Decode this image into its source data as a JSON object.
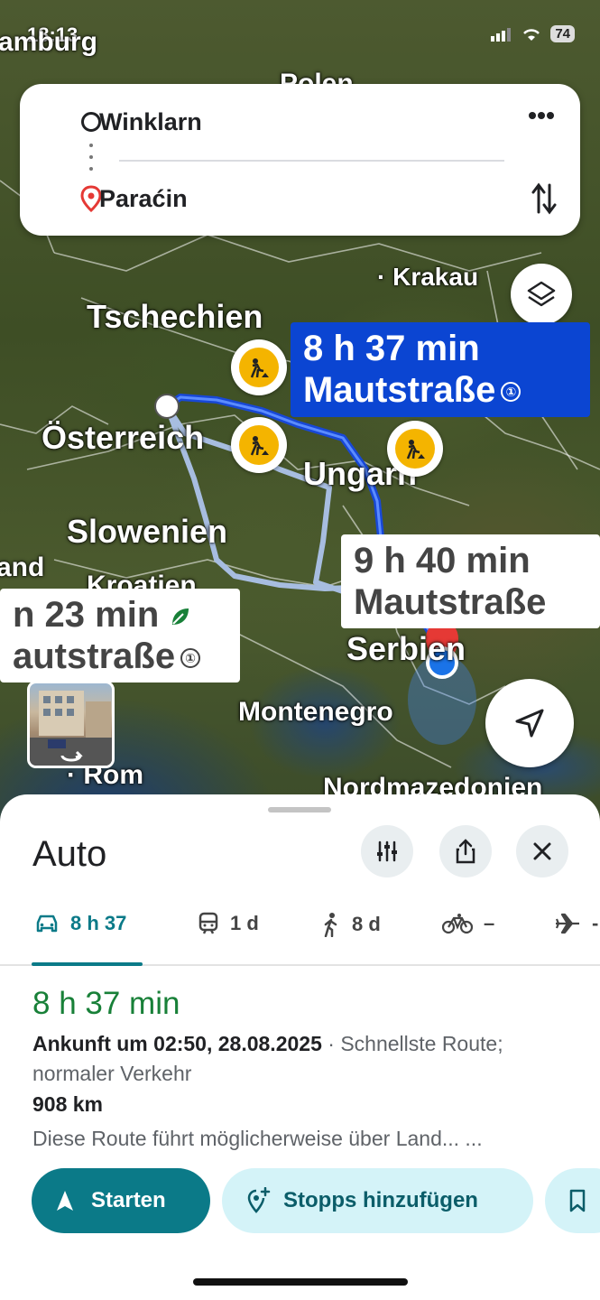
{
  "status_bar": {
    "time": "18:13",
    "battery": "74"
  },
  "map": {
    "places": [
      {
        "name": "amburg"
      },
      {
        "name": "Polen"
      },
      {
        "name": "Krakau"
      },
      {
        "name": "Tschechien"
      },
      {
        "name": "Österreich"
      },
      {
        "name": "Ungarn"
      },
      {
        "name": "Slowenien"
      },
      {
        "name": "and"
      },
      {
        "name": "Kroatien"
      },
      {
        "name": "Serbien"
      },
      {
        "name": "Montenegro"
      },
      {
        "name": "Rom"
      },
      {
        "name": "Nordmazedonien"
      }
    ],
    "route_primary": {
      "duration": "8 h 37 min",
      "note": "Mautstraße"
    },
    "route_alt_1": {
      "duration": "9 h 40 min",
      "note": "Mautstraße"
    },
    "route_alt_2": {
      "duration": "n 23 min",
      "note": "autstraße"
    }
  },
  "search": {
    "origin": "Winklarn",
    "destination": "Paraćin"
  },
  "sheet": {
    "title": "Auto",
    "modes": [
      {
        "label": "8 h 37",
        "icon": "car-icon"
      },
      {
        "label": "1 d",
        "icon": "train-icon"
      },
      {
        "label": "8 d",
        "icon": "walk-icon"
      },
      {
        "label": "–",
        "icon": "bike-icon"
      },
      {
        "label": "-",
        "icon": "plane-icon"
      }
    ],
    "route": {
      "time": "8 h 37 min",
      "arrival": "Ankunft um 02:50, 28.08.2025",
      "arrival_suffix": " · Schnellste Route; normaler Verkehr",
      "distance": "908 km",
      "description": "Diese Route führt möglicherweise über Land... ..."
    },
    "actions": {
      "start": "Starten",
      "add_stops": "Stopps hinzufügen"
    }
  },
  "colors": {
    "accent": "#0b7a88",
    "route_blue": "#0b45d2",
    "time_green": "#188038",
    "roadwork": "#f4b400"
  }
}
